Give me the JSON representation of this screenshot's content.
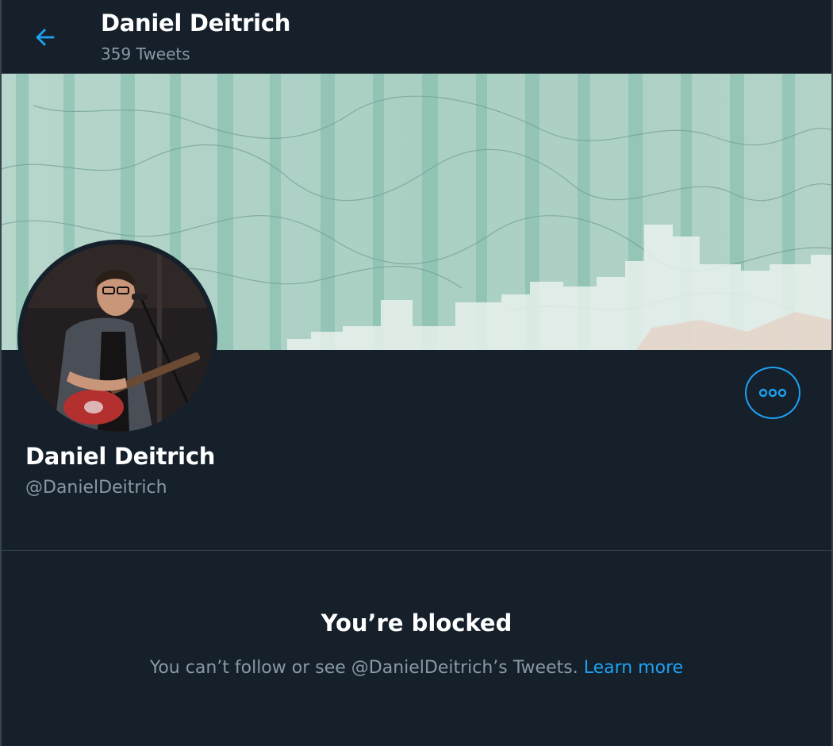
{
  "header": {
    "title": "Daniel Deitrich",
    "tweet_count": "359 Tweets",
    "back_icon": "arrow-left-icon"
  },
  "profile": {
    "name": "Daniel Deitrich",
    "handle": "@DanielDeitrich",
    "more_icon": "more-horizontal-icon"
  },
  "blocked": {
    "title": "You’re blocked",
    "message": "You can’t follow or see @DanielDeitrich’s Tweets.",
    "link_label": "Learn more"
  },
  "colors": {
    "background": "#15202b",
    "accent": "#1da1f2",
    "muted_text": "#8899a6",
    "border": "#38444d"
  }
}
